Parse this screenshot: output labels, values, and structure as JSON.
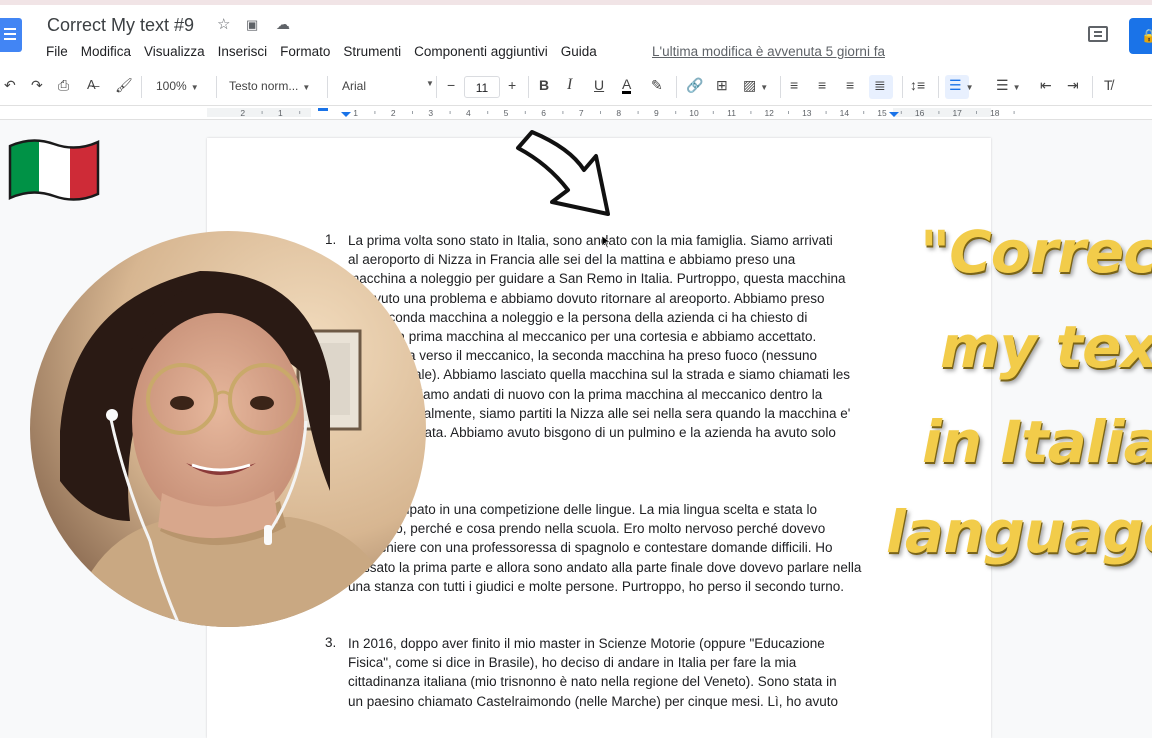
{
  "document": {
    "title": "Correct My text #9",
    "menu": [
      "File",
      "Modifica",
      "Visualizza",
      "Inserisci",
      "Formato",
      "Strumenti",
      "Componenti aggiuntivi",
      "Guida"
    ],
    "last_edit": "L'ultima modifica è avvenuta 5 giorni fa"
  },
  "toolbar": {
    "zoom": "100%",
    "style": "Testo norm...",
    "font": "Arial",
    "font_size": "11",
    "minus": "−",
    "plus": "+",
    "bold": "B",
    "italic": "I",
    "underline": "U",
    "text_color": "A"
  },
  "ruler": {
    "ticks": [
      "2",
      "1",
      "1",
      "2",
      "3",
      "4",
      "5",
      "6",
      "7",
      "8",
      "9",
      "10",
      "11",
      "12",
      "13",
      "14",
      "15",
      "16",
      "17",
      "18"
    ]
  },
  "body": {
    "list_numbers": [
      "1.",
      "3."
    ],
    "para1": [
      "La prima volta sono stato in Italia, sono andato con la mia famiglia. Siamo arrivati",
      "al aeroporto di Nizza in Francia alle sei del la mattina e abbiamo preso una",
      "macchina a noleggio per guidare a San Remo in Italia. Purtroppo, questa macchina",
      "ha avuto una problema e abbiamo dovuto ritornare al areoporto. Abbiamo preso",
      "una seconda macchina a noleggio e la persona della azienda ci ha chiesto di",
      "portare la prima macchina al meccanico per una cortesia e abbiamo accettato.",
      "Nella guida verso il meccanico, la seconda macchina ha preso fuoco (nessuno",
      "si è fatto male). Abbiamo lasciato quella macchina sul la strada e siamo chiamati les",
      "pompiers. Siamo andati di nuovo con la prima macchina al meccanico dentro la",
      "macchina finalmente, siamo partiti la Nizza alle sei nella sera quando la macchina e'",
      "stata aggiustata. Abbiamo avuto bisgono di un pulmino e la azienda ha avuto solo"
    ],
    "para2": [
      "Ho partecipato in una competizione delle lingue. La mia lingua scelta e stata lo",
      "spagnolo, perché e cosa prendo nella scuola. Ero molto nervoso perché dovevo",
      "chiacchiere con una professoressa di spagnolo e contestare domande difficili. Ho",
      "passato la prima parte e allora sono andato alla parte finale dove dovevo parlare nella",
      "una stanza con tutti i giudici e molte persone. Purtroppo, ho perso il secondo turno."
    ],
    "para3": [
      "In 2016, doppo aver finito il mio master in Scienze Motorie (oppure \"Educazione",
      "Fisica\", come si dice in Brasile), ho deciso di andare in Italia per fare la mia",
      "cittadinanza italiana (mio trisnonno è nato nella regione del Veneto). Sono stata in",
      "un paesino chiamato Castelraimondo (nelle Marche) per cinque mesi. Lì, ho avuto"
    ]
  },
  "overlay": {
    "lines": [
      "\"Correct",
      "my text",
      "in Italian",
      "language"
    ],
    "color": "#f2cc4a"
  },
  "colors": {
    "accent": "#1a73e8",
    "flag_green": "#009246",
    "flag_red": "#ce2b37"
  }
}
